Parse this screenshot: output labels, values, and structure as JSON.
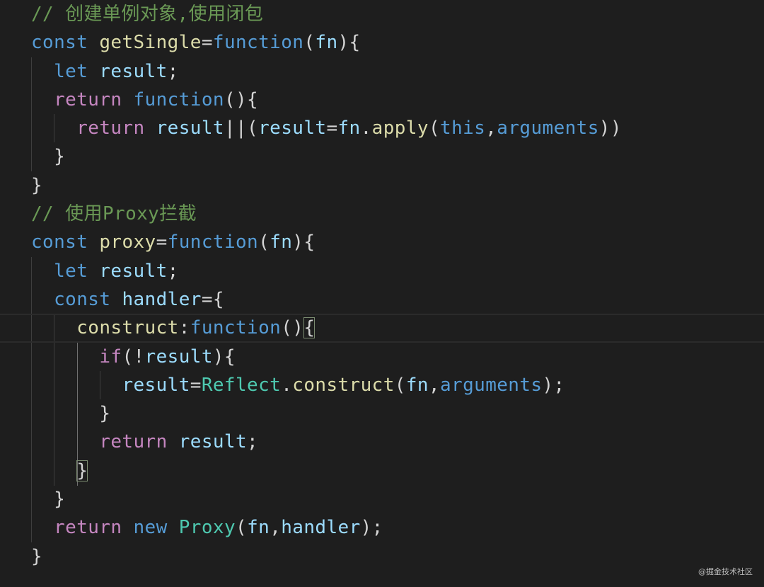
{
  "editor": {
    "theme_colors": {
      "background": "#1e1e1e",
      "keyword_control": "#c586c0",
      "keyword_storage": "#569cd6",
      "function_name": "#dcdcaa",
      "variable": "#9cdcfe",
      "type": "#4ec9b0",
      "plain": "#d4d4d4",
      "comment": "#6a9955"
    },
    "lines": [
      {
        "indent": "",
        "tokens": [
          {
            "t": "cmt",
            "v": "// 创建单例对象,使用闭包"
          }
        ]
      },
      {
        "indent": "",
        "tokens": [
          {
            "t": "k-store",
            "v": "const"
          },
          {
            "t": "plain",
            "v": " "
          },
          {
            "t": "fn-name",
            "v": "getSingle"
          },
          {
            "t": "plain",
            "v": "="
          },
          {
            "t": "k-store",
            "v": "function"
          },
          {
            "t": "plain",
            "v": "("
          },
          {
            "t": "var",
            "v": "fn"
          },
          {
            "t": "plain",
            "v": "){"
          }
        ]
      },
      {
        "indent": "  ",
        "tokens": [
          {
            "t": "k-store",
            "v": "let"
          },
          {
            "t": "plain",
            "v": " "
          },
          {
            "t": "var",
            "v": "result"
          },
          {
            "t": "plain",
            "v": ";"
          }
        ]
      },
      {
        "indent": "  ",
        "tokens": [
          {
            "t": "k-ctrl",
            "v": "return"
          },
          {
            "t": "plain",
            "v": " "
          },
          {
            "t": "k-store",
            "v": "function"
          },
          {
            "t": "plain",
            "v": "(){"
          }
        ]
      },
      {
        "indent": "    ",
        "tokens": [
          {
            "t": "k-ctrl",
            "v": "return"
          },
          {
            "t": "plain",
            "v": " "
          },
          {
            "t": "var",
            "v": "result"
          },
          {
            "t": "plain",
            "v": "||("
          },
          {
            "t": "var",
            "v": "result"
          },
          {
            "t": "plain",
            "v": "="
          },
          {
            "t": "var",
            "v": "fn"
          },
          {
            "t": "plain",
            "v": "."
          },
          {
            "t": "fn-name",
            "v": "apply"
          },
          {
            "t": "plain",
            "v": "("
          },
          {
            "t": "k-store",
            "v": "this"
          },
          {
            "t": "plain",
            "v": ","
          },
          {
            "t": "k-store",
            "v": "arguments"
          },
          {
            "t": "plain",
            "v": "))"
          }
        ]
      },
      {
        "indent": "  ",
        "tokens": [
          {
            "t": "plain",
            "v": "}"
          }
        ]
      },
      {
        "indent": "",
        "tokens": [
          {
            "t": "plain",
            "v": "}"
          }
        ]
      },
      {
        "indent": "",
        "tokens": [
          {
            "t": "cmt",
            "v": "// 使用Proxy拦截"
          }
        ]
      },
      {
        "indent": "",
        "tokens": [
          {
            "t": "k-store",
            "v": "const"
          },
          {
            "t": "plain",
            "v": " "
          },
          {
            "t": "fn-name",
            "v": "proxy"
          },
          {
            "t": "plain",
            "v": "="
          },
          {
            "t": "k-store",
            "v": "function"
          },
          {
            "t": "plain",
            "v": "("
          },
          {
            "t": "var",
            "v": "fn"
          },
          {
            "t": "plain",
            "v": "){"
          }
        ]
      },
      {
        "indent": "  ",
        "tokens": [
          {
            "t": "k-store",
            "v": "let"
          },
          {
            "t": "plain",
            "v": " "
          },
          {
            "t": "var",
            "v": "result"
          },
          {
            "t": "plain",
            "v": ";"
          }
        ]
      },
      {
        "indent": "  ",
        "tokens": [
          {
            "t": "k-store",
            "v": "const"
          },
          {
            "t": "plain",
            "v": " "
          },
          {
            "t": "var",
            "v": "handler"
          },
          {
            "t": "plain",
            "v": "={"
          }
        ]
      },
      {
        "indent": "    ",
        "current": true,
        "tokens": [
          {
            "t": "fn-name",
            "v": "construct"
          },
          {
            "t": "plain",
            "v": ":"
          },
          {
            "t": "k-store",
            "v": "function"
          },
          {
            "t": "plain",
            "v": "()"
          },
          {
            "t": "plain bracket-box",
            "v": "{"
          }
        ]
      },
      {
        "indent": "      ",
        "tokens": [
          {
            "t": "k-ctrl",
            "v": "if"
          },
          {
            "t": "plain",
            "v": "(!"
          },
          {
            "t": "var",
            "v": "result"
          },
          {
            "t": "plain",
            "v": "){"
          }
        ]
      },
      {
        "indent": "        ",
        "tokens": [
          {
            "t": "var",
            "v": "result"
          },
          {
            "t": "plain",
            "v": "="
          },
          {
            "t": "type",
            "v": "Reflect"
          },
          {
            "t": "plain",
            "v": "."
          },
          {
            "t": "fn-name",
            "v": "construct"
          },
          {
            "t": "plain",
            "v": "("
          },
          {
            "t": "var",
            "v": "fn"
          },
          {
            "t": "plain",
            "v": ","
          },
          {
            "t": "k-store",
            "v": "arguments"
          },
          {
            "t": "plain",
            "v": ");"
          }
        ]
      },
      {
        "indent": "      ",
        "tokens": [
          {
            "t": "plain",
            "v": "}"
          }
        ]
      },
      {
        "indent": "      ",
        "tokens": [
          {
            "t": "k-ctrl",
            "v": "return"
          },
          {
            "t": "plain",
            "v": " "
          },
          {
            "t": "var",
            "v": "result"
          },
          {
            "t": "plain",
            "v": ";"
          }
        ]
      },
      {
        "indent": "    ",
        "tokens": [
          {
            "t": "plain bracket-box",
            "v": "}"
          }
        ]
      },
      {
        "indent": "  ",
        "tokens": [
          {
            "t": "plain",
            "v": "}"
          }
        ]
      },
      {
        "indent": "  ",
        "tokens": [
          {
            "t": "k-ctrl",
            "v": "return"
          },
          {
            "t": "plain",
            "v": " "
          },
          {
            "t": "k-store",
            "v": "new"
          },
          {
            "t": "plain",
            "v": " "
          },
          {
            "t": "type",
            "v": "Proxy"
          },
          {
            "t": "plain",
            "v": "("
          },
          {
            "t": "var",
            "v": "fn"
          },
          {
            "t": "plain",
            "v": ","
          },
          {
            "t": "var",
            "v": "handler"
          },
          {
            "t": "plain",
            "v": ");"
          }
        ]
      },
      {
        "indent": "",
        "tokens": [
          {
            "t": "plain",
            "v": "}"
          }
        ]
      }
    ]
  },
  "watermark": {
    "text": "@掘金技术社区"
  }
}
